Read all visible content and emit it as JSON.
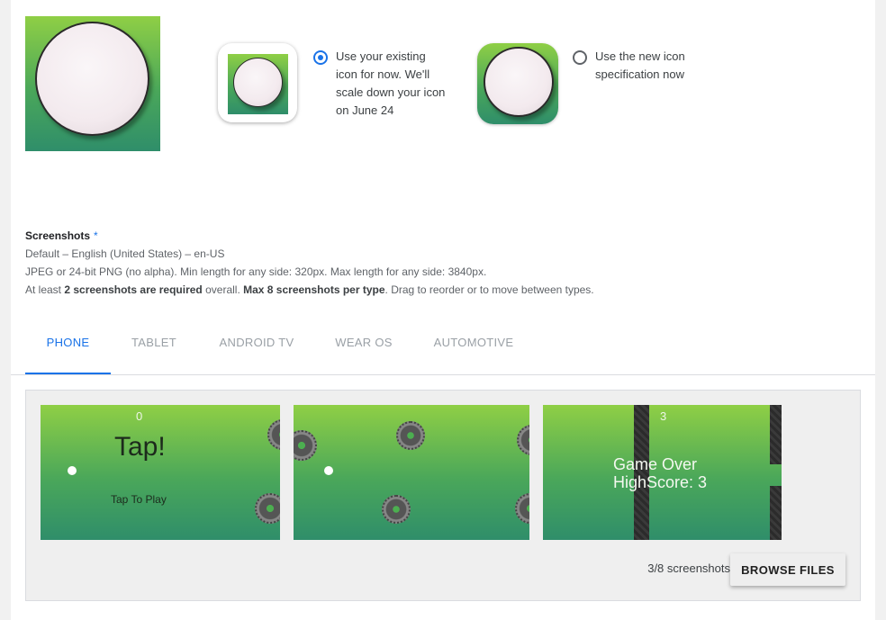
{
  "icon_options": {
    "existing_label": "Use your existing icon for now. We'll scale down your icon on June 24",
    "existing_lines": [
      "Use your existing",
      "icon for now. We'll",
      "scale down your icon",
      "on June 24"
    ],
    "new_lines": [
      "Use the new icon",
      "specification now"
    ],
    "selected": "existing"
  },
  "screenshots": {
    "title": "Screenshots",
    "required_mark": "*",
    "locale": "Default – English (United States) – en-US",
    "format_hint": "JPEG or 24-bit PNG (no alpha). Min length for any side: 320px. Max length for any side: 3840px.",
    "rule_prefix": "At least ",
    "rule_bold1": "2 screenshots are required",
    "rule_mid": " overall. ",
    "rule_bold2": "Max 8 screenshots per type",
    "rule_suffix": ". Drag to reorder or to move between types."
  },
  "tabs": [
    {
      "label": "PHONE",
      "active": true
    },
    {
      "label": "TABLET",
      "active": false
    },
    {
      "label": "ANDROID TV",
      "active": false
    },
    {
      "label": "WEAR OS",
      "active": false
    },
    {
      "label": "AUTOMOTIVE",
      "active": false
    }
  ],
  "gallery": {
    "shots": [
      {
        "score": "0",
        "title": "Tap!",
        "subtitle": "Tap To Play"
      },
      {
        "score": "",
        "title": "",
        "subtitle": ""
      },
      {
        "score": "3",
        "title": "Game Over",
        "subtitle": "HighScore: 3"
      }
    ],
    "count_text": "3/8 screenshots",
    "browse_label": "BROWSE FILES"
  },
  "colors": {
    "accent": "#1a73e8",
    "game_green_top": "#8fcf45",
    "game_green_bottom": "#2f8e6a"
  }
}
